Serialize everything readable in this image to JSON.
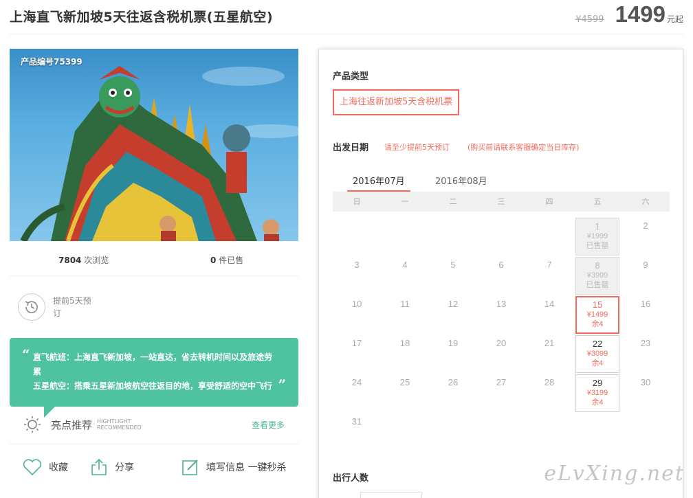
{
  "header": {
    "title": "上海直飞新加坡5天往返含税机票(五星航空)",
    "old_price": "¥4599",
    "price": "1499",
    "price_unit": "元起"
  },
  "hero": {
    "product_no": "产品编号75399"
  },
  "stats": {
    "views_num": "7804",
    "views_label": "次浏览",
    "sold_num": "0",
    "sold_label": "件已售"
  },
  "booking": {
    "text": "提前5天预订"
  },
  "highlight": {
    "line1": "直飞航班：上海直飞新加坡，一站直达，省去转机时间以及旅途劳累",
    "line2": "五星航空：搭乘五星新加坡航空往返目的地，享受舒适的空中飞行",
    "title": "亮点推荐",
    "title_en1": "HIGHTLIGHT",
    "title_en2": "RECOMMENDED",
    "more": "查看更多"
  },
  "actions": {
    "favorite": "收藏",
    "share": "分享",
    "fill_info": "填写信息 一键秒杀"
  },
  "panel": {
    "type_title": "产品类型",
    "type_option": "上海往返新加坡5天含税机票",
    "date_title": "出发日期",
    "note1": "请至少提前5天预订",
    "note2": "(购买前请联系客服确定当日库存)",
    "tabs": [
      "2016年07月",
      "2016年08月"
    ],
    "weekdays": [
      "日",
      "一",
      "二",
      "三",
      "四",
      "五",
      "六"
    ],
    "pax_title": "出行人数"
  },
  "calendar": {
    "days": [
      {
        "day": "1",
        "col": 5,
        "row": 0,
        "state": "sold",
        "price": "¥1999",
        "status": "已售罄"
      },
      {
        "day": "2",
        "col": 6,
        "row": 0
      },
      {
        "day": "3",
        "col": 0,
        "row": 1
      },
      {
        "day": "4",
        "col": 1,
        "row": 1
      },
      {
        "day": "5",
        "col": 2,
        "row": 1
      },
      {
        "day": "6",
        "col": 3,
        "row": 1
      },
      {
        "day": "7",
        "col": 4,
        "row": 1
      },
      {
        "day": "8",
        "col": 5,
        "row": 1,
        "state": "sold",
        "price": "¥3999",
        "status": "已售罄"
      },
      {
        "day": "9",
        "col": 6,
        "row": 1
      },
      {
        "day": "10",
        "col": 0,
        "row": 2
      },
      {
        "day": "11",
        "col": 1,
        "row": 2
      },
      {
        "day": "12",
        "col": 2,
        "row": 2
      },
      {
        "day": "13",
        "col": 3,
        "row": 2
      },
      {
        "day": "14",
        "col": 4,
        "row": 2
      },
      {
        "day": "15",
        "col": 5,
        "row": 2,
        "state": "sel",
        "price": "¥1499",
        "status": "余4"
      },
      {
        "day": "16",
        "col": 6,
        "row": 2
      },
      {
        "day": "17",
        "col": 0,
        "row": 3
      },
      {
        "day": "18",
        "col": 1,
        "row": 3
      },
      {
        "day": "19",
        "col": 2,
        "row": 3
      },
      {
        "day": "20",
        "col": 3,
        "row": 3
      },
      {
        "day": "21",
        "col": 4,
        "row": 3
      },
      {
        "day": "22",
        "col": 5,
        "row": 3,
        "state": "avail",
        "price": "¥3099",
        "status": "余4"
      },
      {
        "day": "23",
        "col": 6,
        "row": 3
      },
      {
        "day": "24",
        "col": 0,
        "row": 4
      },
      {
        "day": "25",
        "col": 1,
        "row": 4
      },
      {
        "day": "26",
        "col": 2,
        "row": 4
      },
      {
        "day": "27",
        "col": 3,
        "row": 4
      },
      {
        "day": "28",
        "col": 4,
        "row": 4
      },
      {
        "day": "29",
        "col": 5,
        "row": 4,
        "state": "avail",
        "price": "¥3199",
        "status": "余4"
      },
      {
        "day": "30",
        "col": 6,
        "row": 4
      },
      {
        "day": "31",
        "col": 0,
        "row": 5
      }
    ]
  },
  "watermark": "eLvXing.net",
  "colors": {
    "accent": "#f26b5a",
    "green": "#4fc3a0"
  }
}
